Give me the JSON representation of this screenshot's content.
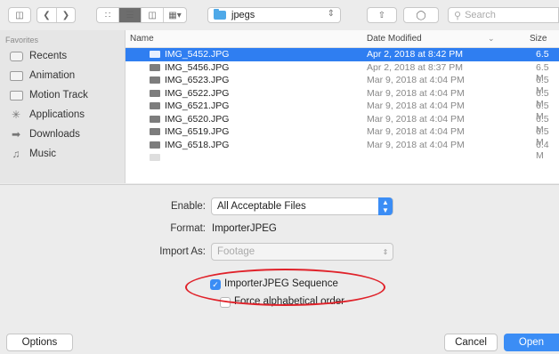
{
  "toolbar": {
    "path": "jpegs",
    "search_placeholder": "Search"
  },
  "sidebar": {
    "heading": "Favorites",
    "items": [
      {
        "label": "Recents",
        "icon": "recents-icon"
      },
      {
        "label": "Animation",
        "icon": "folder-icon"
      },
      {
        "label": "Motion Track",
        "icon": "folder-icon"
      },
      {
        "label": "Applications",
        "icon": "applications-icon"
      },
      {
        "label": "Downloads",
        "icon": "downloads-icon"
      },
      {
        "label": "Music",
        "icon": "music-icon"
      }
    ]
  },
  "file_list": {
    "columns": {
      "name": "Name",
      "date": "Date Modified",
      "size": "Size"
    },
    "rows": [
      {
        "name": "IMG_5452.JPG",
        "date": "Apr 2, 2018 at 8:42 PM",
        "size": "6.5 M"
      },
      {
        "name": "IMG_5456.JPG",
        "date": "Apr 2, 2018 at 8:37 PM",
        "size": "6.5 M"
      },
      {
        "name": "IMG_6523.JPG",
        "date": "Mar 9, 2018 at 4:04 PM",
        "size": "6.5 M"
      },
      {
        "name": "IMG_6522.JPG",
        "date": "Mar 9, 2018 at 4:04 PM",
        "size": "6.5 M"
      },
      {
        "name": "IMG_6521.JPG",
        "date": "Mar 9, 2018 at 4:04 PM",
        "size": "6.5 M"
      },
      {
        "name": "IMG_6520.JPG",
        "date": "Mar 9, 2018 at 4:04 PM",
        "size": "6.5 M"
      },
      {
        "name": "IMG_6519.JPG",
        "date": "Mar 9, 2018 at 4:04 PM",
        "size": "6.5 M"
      },
      {
        "name": "IMG_6518.JPG",
        "date": "Mar 9, 2018 at 4:04 PM",
        "size": "6.4 M"
      }
    ],
    "selected_index": 0
  },
  "options": {
    "enable_label": "Enable:",
    "enable_value": "All Acceptable Files",
    "format_label": "Format:",
    "format_value": "ImporterJPEG",
    "import_as_label": "Import As:",
    "import_as_value": "Footage",
    "sequence_label": "ImporterJPEG Sequence",
    "sequence_checked": true,
    "alpha_label": "Force alphabetical order",
    "alpha_checked": false
  },
  "footer": {
    "options_label": "Options",
    "cancel_label": "Cancel",
    "open_label": "Open"
  },
  "colors": {
    "accent": "#3b8df5",
    "selection": "#2f7ef1",
    "annotation": "#e0222a"
  }
}
